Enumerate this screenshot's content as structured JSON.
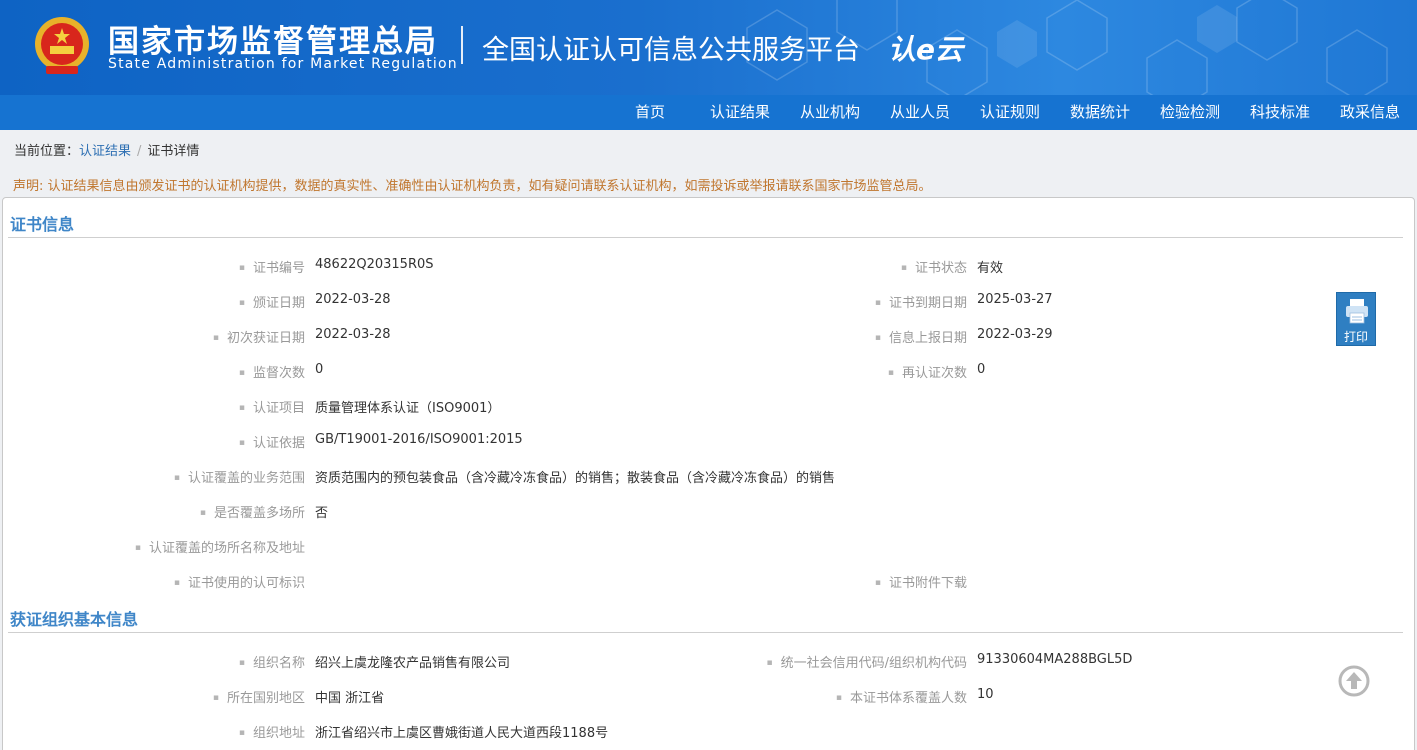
{
  "header": {
    "org_cn": "国家市场监督管理总局",
    "org_en": "State Administration  for  Market Regulation",
    "platform": "全国认证认可信息公共服务平台",
    "logo_mark": "认e云"
  },
  "nav": [
    "首页",
    "认证结果",
    "从业机构",
    "从业人员",
    "认证规则",
    "数据统计",
    "检验检测",
    "科技标准",
    "政采信息"
  ],
  "breadcrumb": {
    "prefix": "当前位置：",
    "link": "认证结果",
    "separator": "/",
    "current": "证书详情"
  },
  "notice": "声明: 认证结果信息由颁发证书的认证机构提供，数据的真实性、准确性由认证机构负责，如有疑问请联系认证机构，如需投诉或举报请联系国家市场监管总局。",
  "cert_section": {
    "title": "证书信息",
    "left_fields": [
      {
        "label": "证书编号",
        "value": "48622Q20315R0S"
      },
      {
        "label": "颁证日期",
        "value": "2022-03-28"
      },
      {
        "label": "初次获证日期",
        "value": "2022-03-28"
      },
      {
        "label": "监督次数",
        "value": "0"
      },
      {
        "label": "认证项目",
        "value": "质量管理体系认证（ISO9001）"
      },
      {
        "label": "认证依据",
        "value": "GB/T19001-2016/ISO9001:2015"
      },
      {
        "label": "认证覆盖的业务范围",
        "value": "资质范围内的预包装食品（含冷藏冷冻食品）的销售；散装食品（含冷藏冷冻食品）的销售"
      },
      {
        "label": "是否覆盖多场所",
        "value": "否"
      },
      {
        "label": "认证覆盖的场所名称及地址",
        "value": ""
      },
      {
        "label": "证书使用的认可标识",
        "value": ""
      }
    ],
    "right_fields": [
      {
        "label": "证书状态",
        "value": "有效"
      },
      {
        "label": "证书到期日期",
        "value": "2025-03-27"
      },
      {
        "label": "信息上报日期",
        "value": "2022-03-29"
      },
      {
        "label": "再认证次数",
        "value": "0"
      },
      {
        "label": "证书附件下载",
        "value": ""
      }
    ]
  },
  "org_section": {
    "title": "获证组织基本信息",
    "left_fields": [
      {
        "label": "组织名称",
        "value": "绍兴上虞龙隆农产品销售有限公司"
      },
      {
        "label": "所在国别地区",
        "value": "中国 浙江省"
      },
      {
        "label": "组织地址",
        "value": "浙江省绍兴市上虞区曹娥街道人民大道西段1188号"
      }
    ],
    "right_fields": [
      {
        "label": "统一社会信用代码/组织机构代码",
        "value": "91330604MA288BGL5D"
      },
      {
        "label": "本证书体系覆盖人数",
        "value": "10"
      }
    ]
  },
  "print_button": {
    "label": "打印",
    "icon": "printer-icon"
  },
  "back_to_top": {
    "icon": "arrow-up-circle-icon"
  },
  "colors": {
    "banner": "#1a6fce",
    "nav": "#1673d1",
    "section_title": "#3f86c8",
    "notice": "#c0762e",
    "link": "#2d6fb3"
  }
}
